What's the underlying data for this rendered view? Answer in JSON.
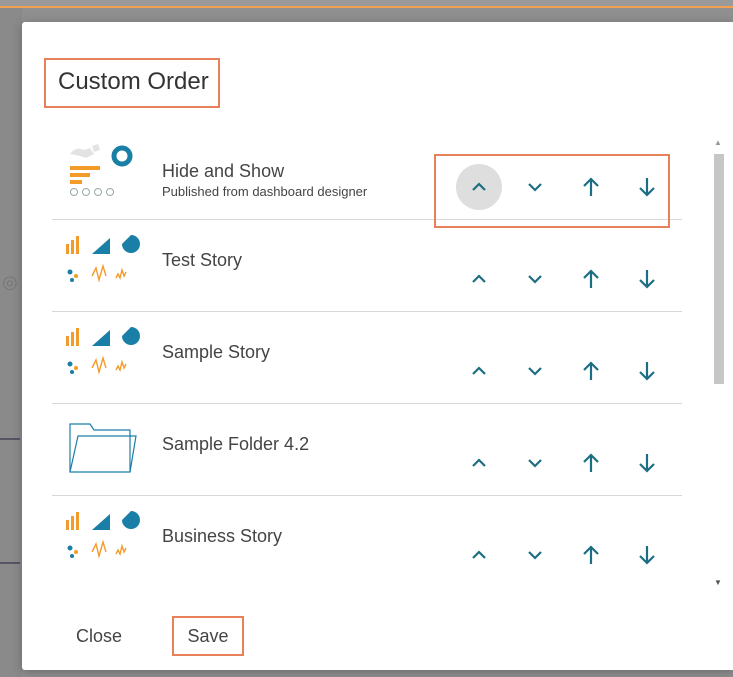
{
  "dialog": {
    "title": "Custom Order",
    "close_label": "Close",
    "save_label": "Save"
  },
  "colors": {
    "accent": "#1c6e82",
    "highlight": "#e8805a"
  },
  "items": [
    {
      "name": "Hide and Show",
      "subtitle": "Published from dashboard designer",
      "icon": "dashboard-thumbnail-icon"
    },
    {
      "name": "Test Story",
      "icon": "story-thumbnail-icon"
    },
    {
      "name": "Sample Story",
      "icon": "story-thumbnail-icon"
    },
    {
      "name": "Sample Folder 4.2",
      "icon": "folder-icon"
    },
    {
      "name": "Business Story",
      "icon": "story-thumbnail-icon"
    }
  ],
  "actions": [
    "move-up-icon",
    "move-down-icon",
    "move-to-top-icon",
    "move-to-bottom-icon"
  ]
}
